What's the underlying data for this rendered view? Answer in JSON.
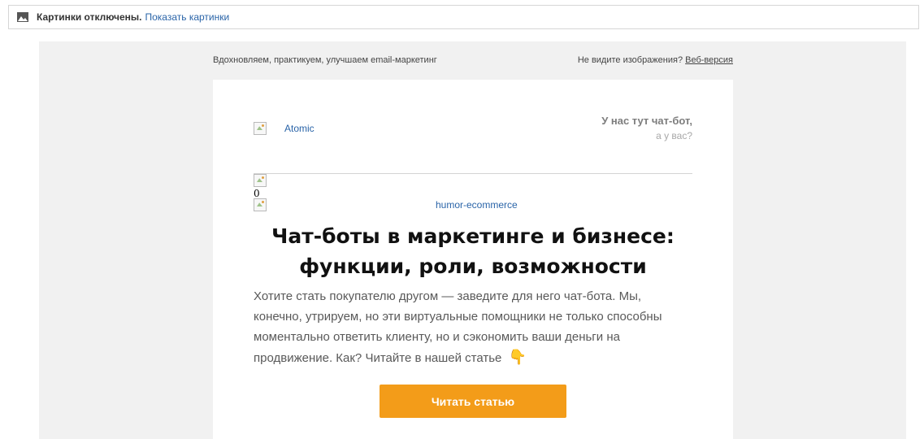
{
  "images_bar": {
    "status": "Картинки отключены.",
    "show_link": "Показать картинки"
  },
  "preheader": {
    "tagline": "Вдохновляем, практикуем, улучшаем email-маркетинг",
    "question": "Не видите изображения?",
    "web_version": "Веб-версия"
  },
  "email": {
    "logo_alt": "Atomic",
    "teaser_title": "У нас тут чат-бот,",
    "teaser_subtitle": "а у вас?",
    "image_alt_zero": "0",
    "hero_alt": "humor-ecommerce",
    "headline": "Чат-боты в маркетинге и бизнесе: функции, роли, возможности",
    "lead": "Хотите стать покупателю другом — заведите для него чат-бота. Мы, конечно, утрируем, но эти виртуальные помощники не только способны моментально ответить клиенту, но и сэкономить ваши деньги на продвижение. Как? Читайте в нашей статье",
    "emoji": "👇",
    "cta_label": "Читать статью"
  },
  "colors": {
    "link": "#2a64a8",
    "cta": "#f39c19",
    "canvas": "#f1f1f1"
  },
  "icons": {
    "images_off": "picture-icon",
    "broken_image": "broken-image-icon"
  }
}
